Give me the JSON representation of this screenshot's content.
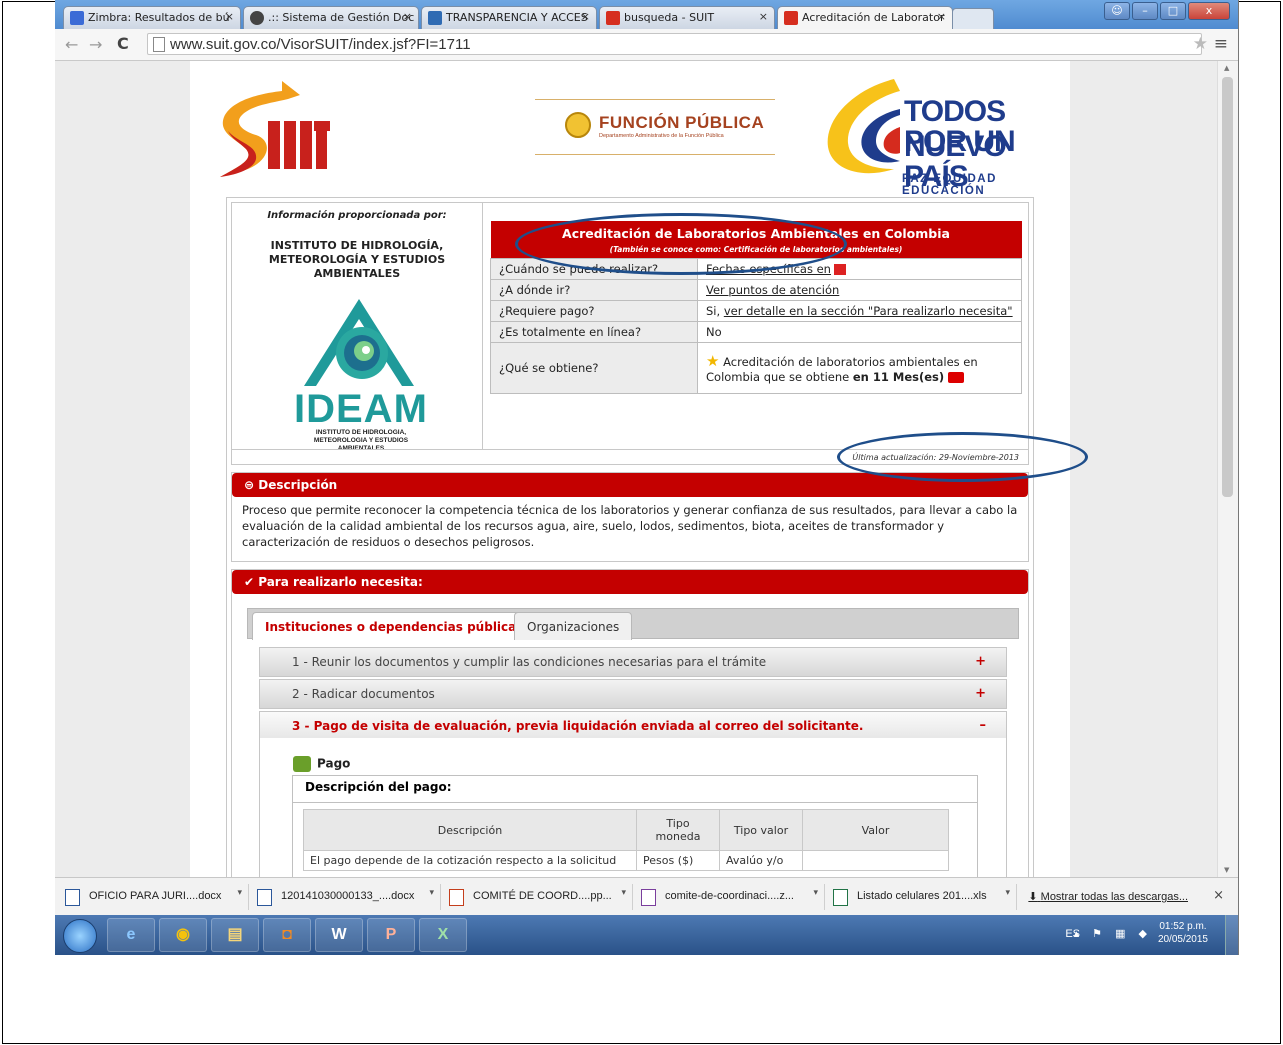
{
  "browser": {
    "tabs": [
      {
        "label": "Zimbra: Resultados de bú",
        "color": "#3b6bd6"
      },
      {
        "label": ".:: Sistema de Gestión Doc",
        "color": "#444444"
      },
      {
        "label": "TRANSPARENCIA Y ACCES",
        "color": "#2f6bb3"
      },
      {
        "label": "busqueda - SUIT",
        "color": "#d62e1f"
      },
      {
        "label": "Acreditación de Laborator",
        "color": "#d62e1f"
      }
    ],
    "url": "www.suit.gov.co/VisorSUIT/index.jsf?FI=1711",
    "close_glyph": "×",
    "back_glyph": "←",
    "forward_glyph": "→",
    "reload_glyph": "C",
    "star_glyph": "★",
    "menu_glyph": "≡",
    "minimize_glyph": "–",
    "maximize_glyph": "□",
    "window_close_glyph": "x",
    "user_glyph": "☺",
    "scroll_up_glyph": "▲",
    "scroll_down_glyph": "▼"
  },
  "header": {
    "funcion_publica": "FUNCIÓN PÚBLICA",
    "funcion_sub": "Departamento Administrativo de la Función Pública",
    "todos_l1": "TODOS POR UN",
    "todos_l2": "NUEVO PAÍS",
    "todos_sub": "PAZ  EQUIDAD  EDUCACIÓN"
  },
  "provider": {
    "label": "Información proporcionada por:",
    "name": "INSTITUTO DE HIDROLOGÍA, METEOROLOGÍA Y ESTUDIOS AMBIENTALES",
    "logo_word": "IDEAM",
    "logo_caption": "INSTITUTO DE HIDROLOGIA, METEOROLOGIA Y ESTUDIOS AMBIENTALES"
  },
  "tramite": {
    "title": "Acreditación de Laboratorios Ambientales en Colombia",
    "aka": "(También se conoce como: Certificación de laboratorios ambientales)",
    "rows": [
      {
        "q": "¿Cuándo se puede realizar?",
        "a": "Fechas específicas en"
      },
      {
        "q": "¿A dónde ir?",
        "a": "Ver puntos de atención"
      },
      {
        "q": "¿Requiere pago?",
        "a_prefix": "Si,",
        "a": "ver detalle en la sección \"Para realizarlo necesita\""
      },
      {
        "q": "¿Es totalmente en línea?",
        "a": "No"
      },
      {
        "q": "¿Qué se obtiene?",
        "a": "Acreditación de laboratorios ambientales en Colombia que se obtiene",
        "a_bold": "en 11 Mes(es)"
      }
    ],
    "updated": "Última actualización: 29-Noviembre-2013"
  },
  "descripcion": {
    "heading": "Descripción",
    "text": "Proceso que permite reconocer la competencia técnica de los laboratorios y generar confianza de sus resultados, para llevar a cabo la evaluación de la calidad ambiental de los recursos agua, aire, suelo, lodos, sedimentos, biota, aceites de transformador y caracterización de residuos o desechos peligrosos."
  },
  "requisitos": {
    "heading": "Para realizarlo necesita:",
    "tabs": [
      "Instituciones o dependencias públicas",
      "Organizaciones"
    ],
    "steps": [
      {
        "label": "1 - Reunir los documentos y cumplir las condiciones necesarias para el trámite",
        "sign": "+"
      },
      {
        "label": "2 - Radicar documentos",
        "sign": "+"
      },
      {
        "label": "3 - Pago de visita de evaluación, previa liquidación enviada al correo del solicitante.",
        "sign": "–"
      }
    ],
    "pago_title": "Pago",
    "pago_desc_label": "Descripción del pago:",
    "pay_columns": [
      "Descripción",
      "Tipo moneda",
      "Tipo valor",
      "Valor"
    ],
    "pay_row": [
      "El pago depende de la cotización respecto a la solicitud",
      "Pesos ($)",
      "Avalúo y/o",
      ""
    ]
  },
  "downloads": {
    "items": [
      "OFICIO PARA JURI....docx",
      "120141030000133_....docx",
      "COMITÉ DE COORD....pp...",
      "comite-de-coordinaci....z...",
      "Listado celulares 201....xls"
    ],
    "show_all": "Mostrar todas las descargas...",
    "arrow_glyph": "▾",
    "download_glyph": "⬇"
  },
  "taskbar": {
    "apps": [
      "e",
      "◉",
      "▤",
      "◘",
      "W",
      "P",
      "X"
    ],
    "lang": "ES",
    "tray_icons": "▴ ⚑ ▦ ◆",
    "time": "01:52 p.m.",
    "date": "20/05/2015"
  }
}
